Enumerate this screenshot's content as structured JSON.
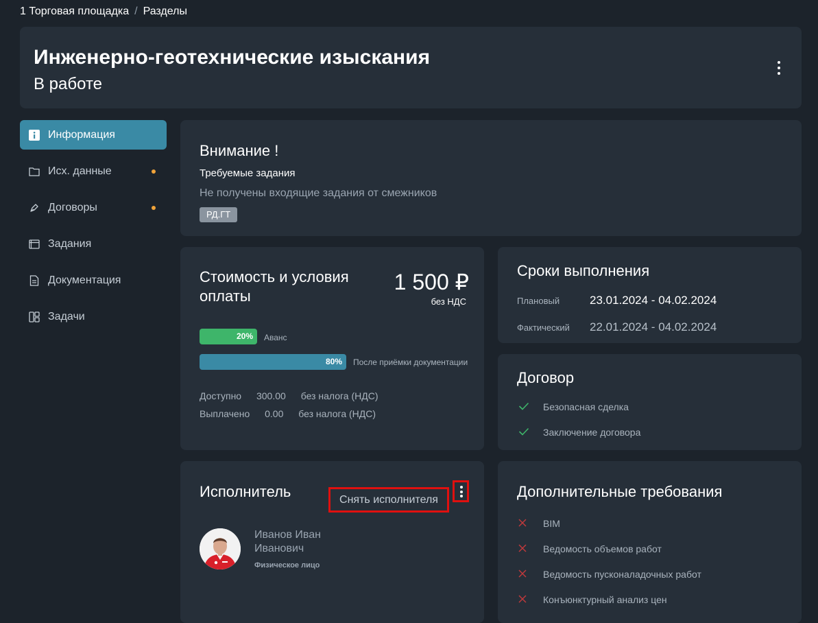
{
  "breadcrumb": {
    "root": "1 Торговая площадка",
    "separator": "/",
    "current": "Разделы"
  },
  "header": {
    "title": "Инженерно-геотехнические изыскания",
    "status": "В работе"
  },
  "sidebar": {
    "items": [
      {
        "label": "Информация",
        "icon": "info-icon",
        "active": true,
        "dot": false
      },
      {
        "label": "Исх. данные",
        "icon": "folder-icon",
        "active": false,
        "dot": true
      },
      {
        "label": "Договоры",
        "icon": "pen-icon",
        "active": false,
        "dot": true
      },
      {
        "label": "Задания",
        "icon": "cards-icon",
        "active": false,
        "dot": false
      },
      {
        "label": "Документация",
        "icon": "document-icon",
        "active": false,
        "dot": false
      },
      {
        "label": "Задачи",
        "icon": "board-icon",
        "active": false,
        "dot": false
      }
    ]
  },
  "attention": {
    "title": "Внимание !",
    "subtitle": "Требуемые задания",
    "text": "Не получены входящие задания от смежников",
    "badge": "РД.ГТ"
  },
  "cost": {
    "title": "Стоимость и условия оплаты",
    "amount": "1 500 ₽",
    "amount_note": "без НДС",
    "payments": [
      {
        "percent": 20,
        "percent_label": "20%",
        "label": "Аванс",
        "color": "#3eb56a"
      },
      {
        "percent": 80,
        "percent_label": "80%",
        "label": "После приёмки документации",
        "color": "#3a8aa5"
      }
    ],
    "available_label": "Доступно",
    "available_value": "300.00",
    "available_note": "без налога (НДС)",
    "paid_label": "Выплачено",
    "paid_value": "0.00",
    "paid_note": "без налога (НДС)"
  },
  "terms": {
    "title": "Сроки выполнения",
    "planned_label": "Плановый",
    "planned_value": "23.01.2024 - 04.02.2024",
    "actual_label": "Фактический",
    "actual_value": "22.01.2024 - 04.02.2024"
  },
  "contract": {
    "title": "Договор",
    "items": [
      "Безопасная сделка",
      "Заключение договора"
    ]
  },
  "executor": {
    "title": "Исполнитель",
    "remove_label": "Снять исполнителя",
    "name": "Иванов Иван Иванович",
    "type": "Физическое лицо"
  },
  "requirements": {
    "title": "Дополнительные требования",
    "items": [
      "BIM",
      "Ведомость объемов работ",
      "Ведомость пусконаладочных работ",
      "Конъюнктурный анализ цен"
    ]
  },
  "colors": {
    "accent": "#3a8aa5",
    "success": "#3eb56a",
    "dot": "#f0a33a",
    "highlight": "#e0100f",
    "error": "#c0393b"
  }
}
